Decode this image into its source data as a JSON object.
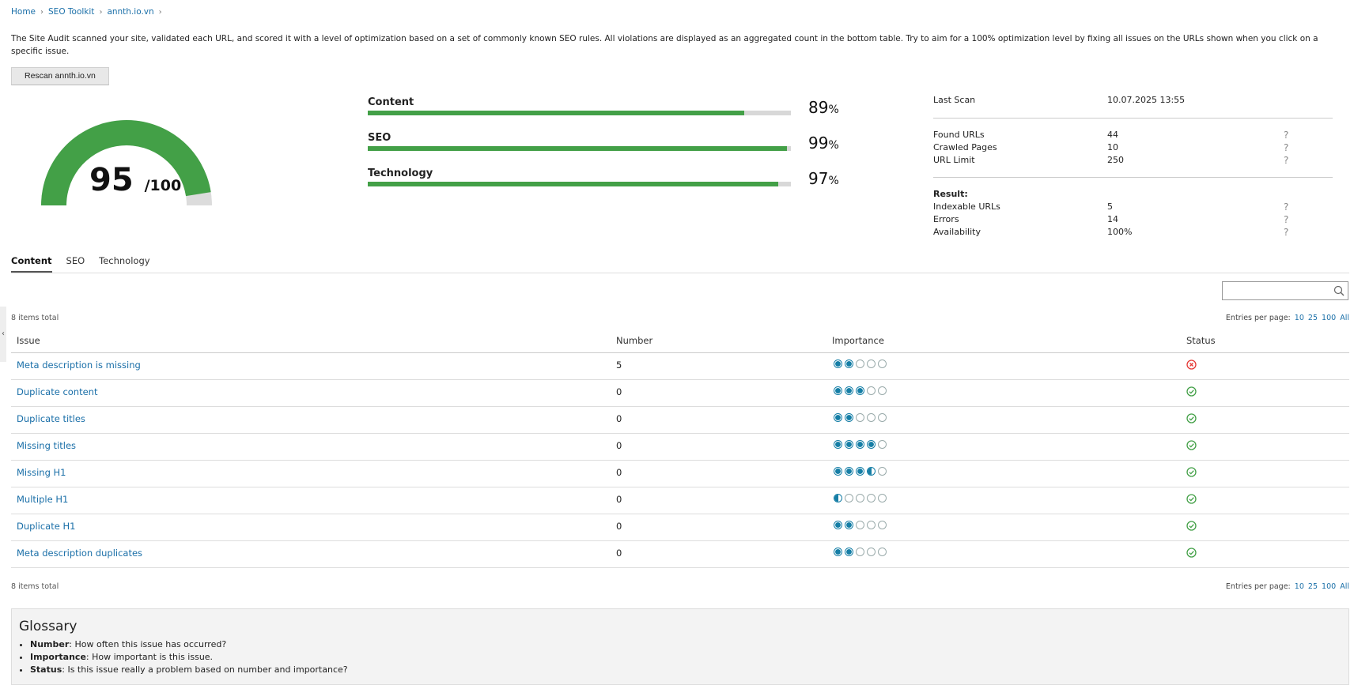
{
  "breadcrumb": [
    {
      "label": "Home"
    },
    {
      "label": "SEO Toolkit"
    },
    {
      "label": "annth.io.vn"
    }
  ],
  "intro": "The Site Audit scanned your site, validated each URL, and scored it with a level of optimization based on a set of commonly known SEO rules. All violations are displayed as an aggregated count in the bottom table. Try to aim for a 100% optimization level by fixing all issues on the URLs shown when you click on a specific issue.",
  "rescan_label": "Rescan annth.io.vn",
  "score": {
    "value": "95",
    "max": "/100",
    "fraction": 0.95,
    "color": "#43a047"
  },
  "categories": [
    {
      "label": "Content",
      "pct": "89",
      "unit": "%",
      "fraction": 0.89
    },
    {
      "label": "SEO",
      "pct": "99",
      "unit": "%",
      "fraction": 0.99
    },
    {
      "label": "Technology",
      "pct": "97",
      "unit": "%",
      "fraction": 0.97
    }
  ],
  "info": {
    "last_scan_label": "Last Scan",
    "last_scan_value": "10.07.2025 13:55",
    "found_urls_label": "Found URLs",
    "found_urls_value": "44",
    "crawled_label": "Crawled Pages",
    "crawled_value": "10",
    "limit_label": "URL Limit",
    "limit_value": "250",
    "result_label": "Result:",
    "indexable_label": "Indexable URLs",
    "indexable_value": "5",
    "errors_label": "Errors",
    "errors_value": "14",
    "availability_label": "Availability",
    "availability_value": "100%",
    "help": "?"
  },
  "tabs": [
    {
      "label": "Content",
      "active": true
    },
    {
      "label": "SEO",
      "active": false
    },
    {
      "label": "Technology",
      "active": false
    }
  ],
  "search": {
    "placeholder": ""
  },
  "items_total": "8 items total",
  "entries": {
    "label": "Entries per page:",
    "options": [
      "10",
      "25",
      "100",
      "All"
    ]
  },
  "table": {
    "headers": {
      "issue": "Issue",
      "number": "Number",
      "importance": "Importance",
      "status": "Status"
    },
    "rows": [
      {
        "issue": "Meta description is missing",
        "number": "5",
        "importance": 2,
        "status": "error"
      },
      {
        "issue": "Duplicate content",
        "number": "0",
        "importance": 3,
        "status": "ok"
      },
      {
        "issue": "Duplicate titles",
        "number": "0",
        "importance": 2,
        "status": "ok"
      },
      {
        "issue": "Missing titles",
        "number": "0",
        "importance": 4,
        "status": "ok"
      },
      {
        "issue": "Missing H1",
        "number": "0",
        "importance": 3.5,
        "status": "ok"
      },
      {
        "issue": "Multiple H1",
        "number": "0",
        "importance": 0.5,
        "status": "ok"
      },
      {
        "issue": "Duplicate H1",
        "number": "0",
        "importance": 2,
        "status": "ok"
      },
      {
        "issue": "Meta description duplicates",
        "number": "0",
        "importance": 2,
        "status": "ok"
      }
    ]
  },
  "glossary": {
    "title": "Glossary",
    "items": [
      {
        "term": "Number",
        "text": ": How often this issue has occurred?"
      },
      {
        "term": "Importance",
        "text": ": How important is this issue."
      },
      {
        "term": "Status",
        "text": ": Is this issue really a problem based on number and importance?"
      }
    ]
  },
  "colors": {
    "accent": "#1a6fa8",
    "ok": "#43a047",
    "error": "#e53935",
    "dot": "#157ea6"
  }
}
